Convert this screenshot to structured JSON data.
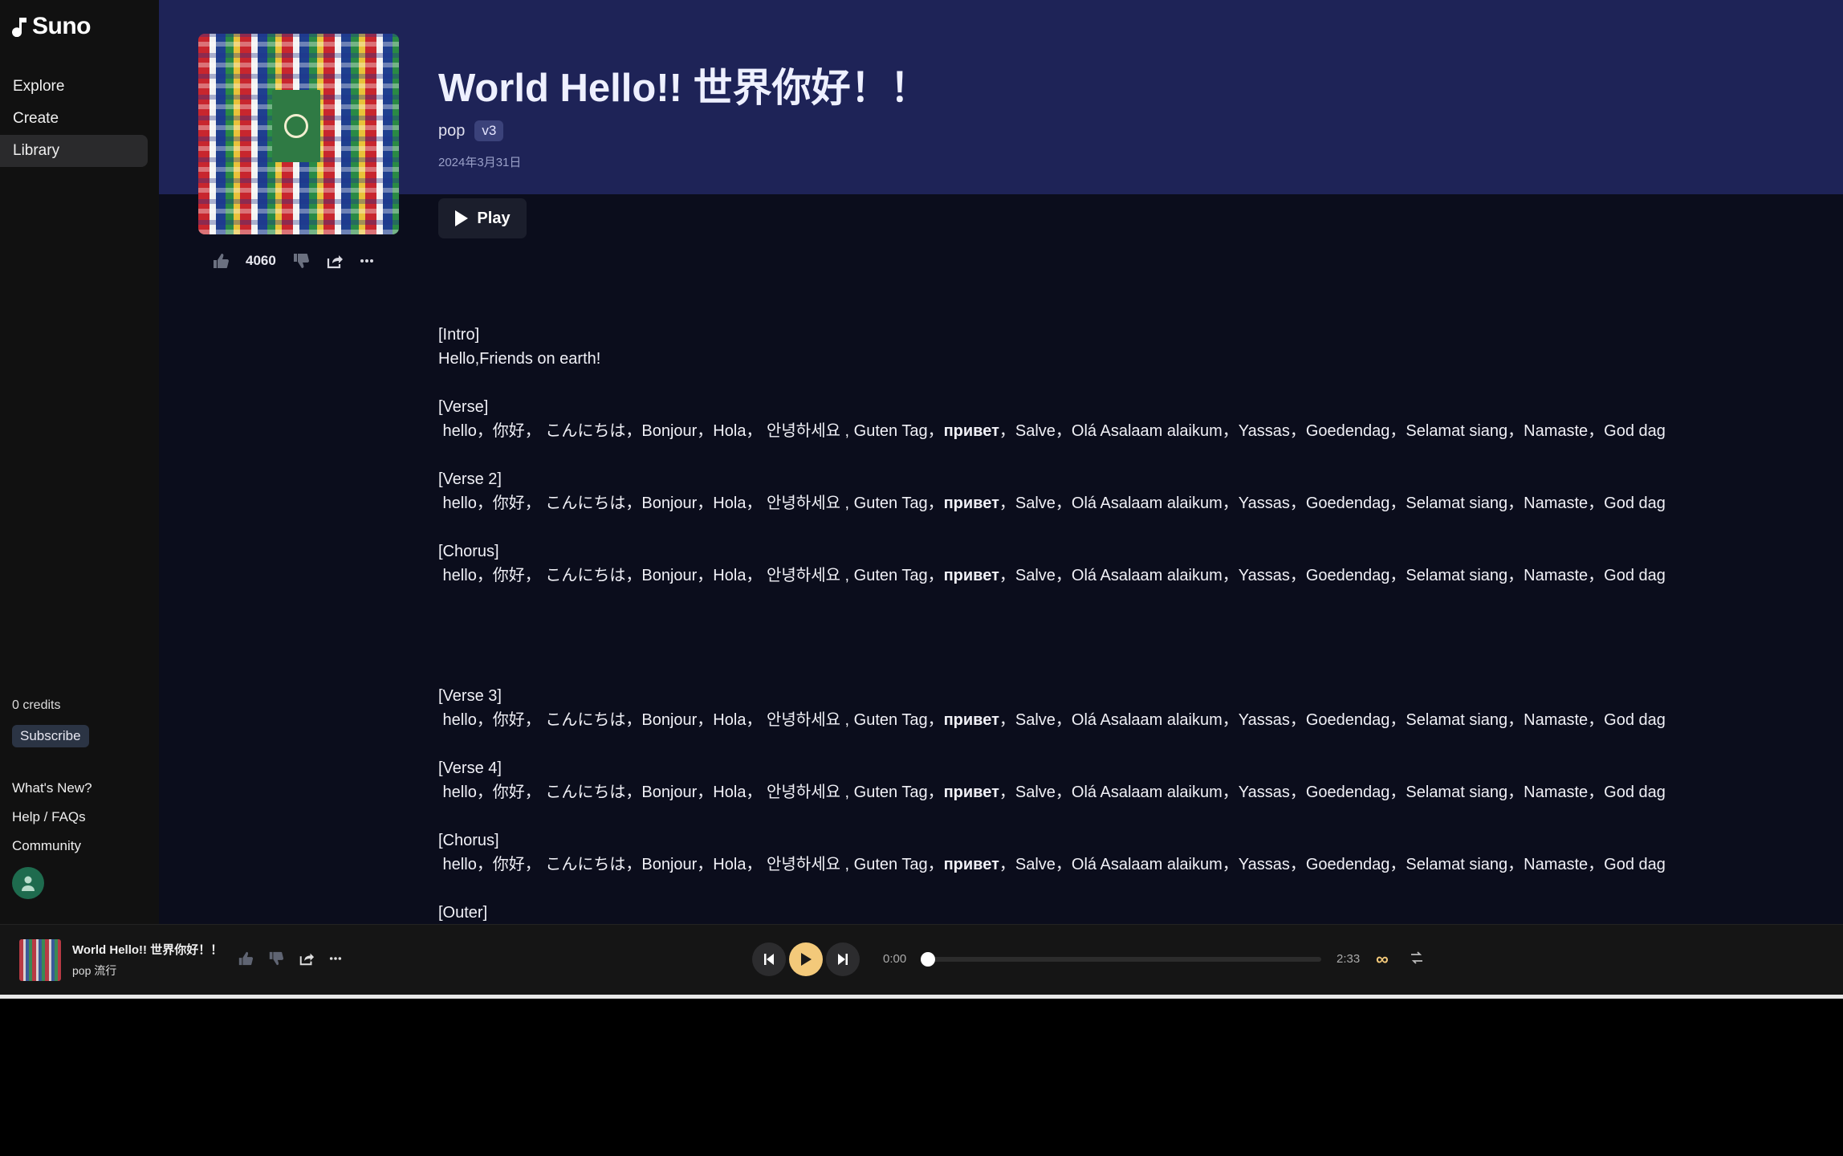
{
  "app": {
    "brand": "Suno"
  },
  "sidebar": {
    "nav": [
      {
        "label": "Explore"
      },
      {
        "label": "Create"
      },
      {
        "label": "Library",
        "active": true
      }
    ],
    "credits": "0 credits",
    "subscribe_label": "Subscribe",
    "links": [
      {
        "label": "What's New?"
      },
      {
        "label": "Help / FAQs"
      },
      {
        "label": "Community"
      }
    ]
  },
  "song": {
    "title": "World Hello!! 世界你好！！",
    "genre": "pop",
    "version": "v3",
    "date": "2024年3月31日",
    "play_label": "Play",
    "likes": "4060"
  },
  "lyrics": [
    {
      "text": "[Intro]"
    },
    {
      "text": "Hello,Friends on earth!"
    },
    {
      "text": ""
    },
    {
      "text": "[Verse]"
    },
    {
      "pre": " hello，你好， こんにちは，Bonjour，Hola， 안녕하세요 , Guten Tag，",
      "bold": "привет",
      "post": "，Salve，Olá Asalaam alaikum，Yassas，Goedendag，Selamat siang，Namaste，God dag"
    },
    {
      "text": ""
    },
    {
      "text": "[Verse 2]"
    },
    {
      "pre": " hello，你好， こんにちは，Bonjour，Hola， 안녕하세요 , Guten Tag，",
      "bold": "привет",
      "post": "，Salve，Olá Asalaam alaikum，Yassas，Goedendag，Selamat siang，Namaste，God dag"
    },
    {
      "text": ""
    },
    {
      "text": "[Chorus]"
    },
    {
      "pre": " hello，你好， こんにちは，Bonjour，Hola， 안녕하세요 , Guten Tag，",
      "bold": "привет",
      "post": "，Salve，Olá Asalaam alaikum，Yassas，Goedendag，Selamat siang，Namaste，God dag"
    },
    {
      "text": ""
    },
    {
      "text": ""
    },
    {
      "text": ""
    },
    {
      "text": ""
    },
    {
      "text": "[Verse 3]"
    },
    {
      "pre": " hello，你好， こんにちは，Bonjour，Hola， 안녕하세요 , Guten Tag，",
      "bold": "привет",
      "post": "，Salve，Olá Asalaam alaikum，Yassas，Goedendag，Selamat siang，Namaste，God dag"
    },
    {
      "text": ""
    },
    {
      "text": "[Verse 4]"
    },
    {
      "pre": " hello，你好， こんにちは，Bonjour，Hola， 안녕하세요 , Guten Tag，",
      "bold": "привет",
      "post": "，Salve，Olá Asalaam alaikum，Yassas，Goedendag，Selamat siang，Namaste，God dag"
    },
    {
      "text": ""
    },
    {
      "text": "[Chorus]"
    },
    {
      "pre": " hello，你好， こんにちは，Bonjour，Hola， 안녕하세요 , Guten Tag，",
      "bold": "привет",
      "post": "，Salve，Olá Asalaam alaikum，Yassas，Goedendag，Selamat siang，Namaste，God dag"
    },
    {
      "text": ""
    },
    {
      "text": "[Outer]"
    }
  ],
  "player": {
    "title": "World Hello!! 世界你好！！",
    "subtitle": "pop  流行",
    "current_time": "0:00",
    "total_time": "2:33",
    "progress": 0,
    "accent": "#f3c97a",
    "loop_icon": "infinity-icon",
    "queue_icon": "shuffle-icon"
  },
  "colors": {
    "header_band": "#1e2357",
    "background": "#0b0d1c",
    "sidebar": "#111111"
  }
}
